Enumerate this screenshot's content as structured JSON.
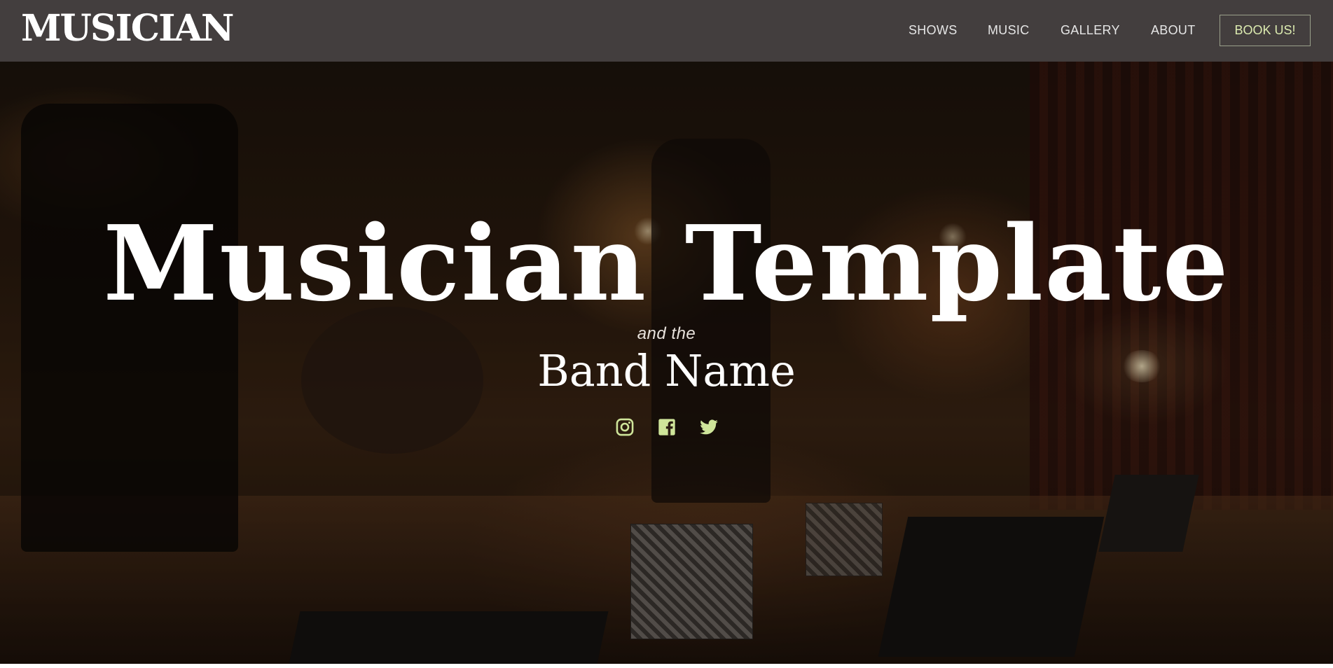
{
  "navbar": {
    "brand": "MUSICIAN",
    "items": [
      {
        "label": "SHOWS"
      },
      {
        "label": "MUSIC"
      },
      {
        "label": "GALLERY"
      },
      {
        "label": "ABOUT"
      }
    ],
    "cta_label": "BOOK US!"
  },
  "hero": {
    "title": "Musician Template",
    "subtitle": "and the",
    "band_name": "Band Name",
    "social_icons": [
      "instagram-icon",
      "facebook-icon",
      "twitter-icon"
    ]
  },
  "colors": {
    "navbar_bg": "#433e3e",
    "accent": "#dcebb0",
    "icon": "#cfe59a"
  }
}
